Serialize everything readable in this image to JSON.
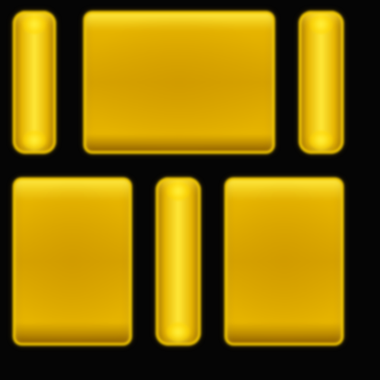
{
  "icon": {
    "name": "gold-brick-wall-icon",
    "colors": {
      "background": "#000000",
      "brick_base": "#E6B400",
      "brick_mid": "#D6A200",
      "brick_highlight": "#FFE838",
      "brick_shadow": "#9A6A00",
      "brick_edge": "#F2C800"
    },
    "bricks": [
      {
        "name": "brick-top-left-slim",
        "shape": "slim"
      },
      {
        "name": "brick-top-center-wide",
        "shape": "wide"
      },
      {
        "name": "brick-top-right-slim",
        "shape": "slim"
      },
      {
        "name": "brick-bottom-left-wide",
        "shape": "wide"
      },
      {
        "name": "brick-bottom-center-slim",
        "shape": "slim"
      },
      {
        "name": "brick-bottom-right-wide",
        "shape": "wide"
      }
    ]
  }
}
